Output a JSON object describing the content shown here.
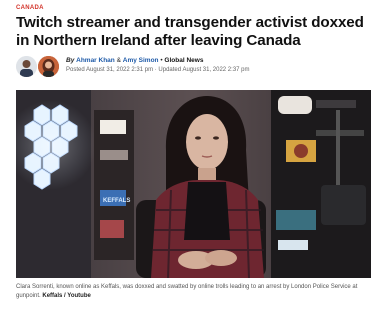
{
  "article": {
    "category": "CANADA",
    "headline": "Twitch streamer and transgender activist doxxed in Northern Ireland after leaving Canada",
    "byline": {
      "by": "By",
      "author1": "Ahmar Khan",
      "amp": "&",
      "author2": "Amy Simon",
      "separator": "•",
      "organization": "Global News",
      "posted": "Posted August 31, 2022 2:31 pm",
      "date_separator": "·",
      "updated": "Updated August 31, 2022 2:37 pm"
    },
    "photo": {
      "screen_text": "KEFFALS"
    },
    "caption": {
      "text": "Clara Sorrenti, known online as Keffals, was doxxed and swatted by online trolls leading to an arrest by London Police Service at gunpoint.",
      "credit": "Keffals / Youtube"
    }
  },
  "colors": {
    "category": "#d3342b",
    "author_link": "#1e5aa8"
  }
}
